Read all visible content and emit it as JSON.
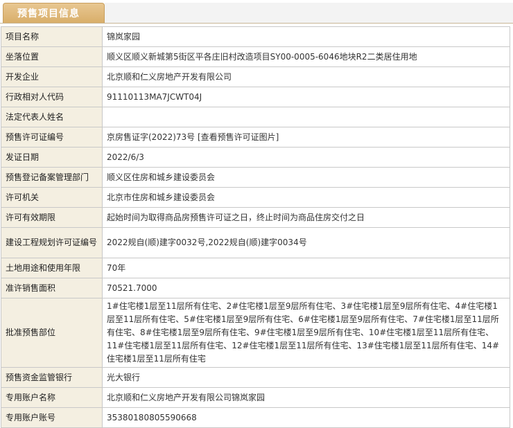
{
  "tab": {
    "label": "预售项目信息"
  },
  "rows": [
    {
      "label": "项目名称",
      "value": "锦岚家园"
    },
    {
      "label": "坐落位置",
      "value": "顺义区顺义新城第5街区平各庄旧村改造项目SY00-0005-6046地块R2二类居住用地"
    },
    {
      "label": "开发企业",
      "value": "北京顺和仁义房地产开发有限公司"
    },
    {
      "label": "行政相对人代码",
      "value": "91110113MA7JCWT04J"
    },
    {
      "label": "法定代表人姓名",
      "value": ""
    },
    {
      "label": "预售许可证编号",
      "value": "京房售证字(2022)73号 [查看预售许可证图片]"
    },
    {
      "label": "发证日期",
      "value": "2022/6/3"
    },
    {
      "label": "预售登记备案管理部门",
      "value": "顺义区住房和城乡建设委员会"
    },
    {
      "label": "许可机关",
      "value": "北京市住房和城乡建设委员会"
    },
    {
      "label": "许可有效期限",
      "value": "起始时间为取得商品房预售许可证之日，终止时间为商品住房交付之日"
    },
    {
      "label": "建设工程规划许可证编号",
      "value": "2022规自(顺)建字0032号,2022规自(顺)建字0034号"
    },
    {
      "label": "土地用途和使用年限",
      "value": "70年"
    },
    {
      "label": "准许销售面积",
      "value": "70521.7000"
    },
    {
      "label": "批准预售部位",
      "value": "1#住宅楼1层至11层所有住宅、2#住宅楼1层至9层所有住宅、3#住宅楼1层至9层所有住宅、4#住宅楼1层至11层所有住宅、5#住宅楼1层至9层所有住宅、6#住宅楼1层至9层所有住宅、7#住宅楼1层至11层所有住宅、8#住宅楼1层至9层所有住宅、9#住宅楼1层至9层所有住宅、10#住宅楼1层至11层所有住宅、11#住宅楼1层至11层所有住宅、12#住宅楼1层至11层所有住宅、13#住宅楼1层至11层所有住宅、14#住宅楼1层至11层所有住宅"
    },
    {
      "label": "预售资金监管银行",
      "value": "光大银行"
    },
    {
      "label": "专用账户名称",
      "value": "北京顺和仁义房地产开发有限公司锦岚家园"
    },
    {
      "label": "专用账户账号",
      "value": "35380180805590668"
    }
  ]
}
